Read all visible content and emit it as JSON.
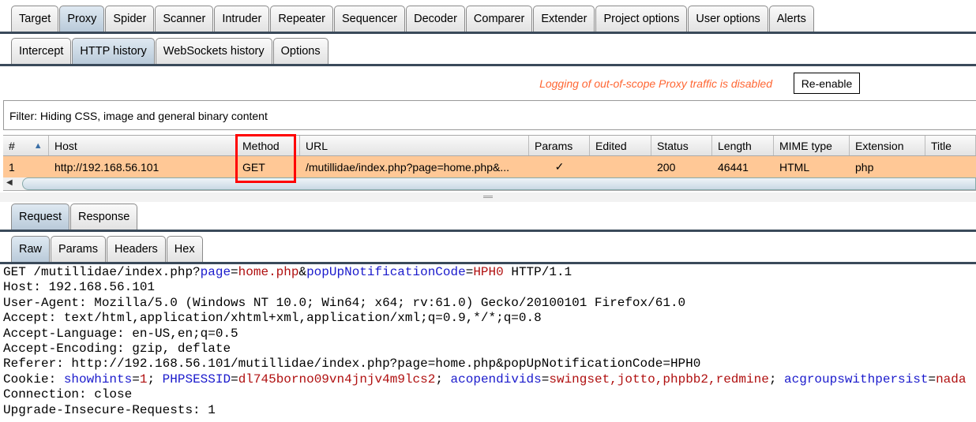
{
  "main_tabs": [
    "Target",
    "Proxy",
    "Spider",
    "Scanner",
    "Intruder",
    "Repeater",
    "Sequencer",
    "Decoder",
    "Comparer",
    "Extender",
    "Project options",
    "User options",
    "Alerts"
  ],
  "main_active": 1,
  "proxy_tabs": [
    "Intercept",
    "HTTP history",
    "WebSockets history",
    "Options"
  ],
  "proxy_active": 1,
  "logging": {
    "message": "Logging of out-of-scope Proxy traffic is disabled",
    "button": "Re-enable"
  },
  "filter": "Filter: Hiding CSS, image and general binary content",
  "table": {
    "columns": [
      "#",
      "Host",
      "Method",
      "URL",
      "Params",
      "Edited",
      "Status",
      "Length",
      "MIME type",
      "Extension",
      "Title"
    ],
    "sort_indicator": "▲",
    "rows": [
      [
        "1",
        "http://192.168.56.101",
        "GET",
        "/mutillidae/index.php?page=home.php&...",
        "✓",
        "",
        "200",
        "46441",
        "HTML",
        "php",
        ""
      ]
    ]
  },
  "msg_tabs": [
    "Request",
    "Response"
  ],
  "view_tabs": [
    "Raw",
    "Params",
    "Headers",
    "Hex"
  ],
  "request_lines": [
    [
      [
        "t",
        "GET /mutillidae/index.php?"
      ],
      [
        "k",
        "page"
      ],
      [
        "t",
        "="
      ],
      [
        "v",
        "home.php"
      ],
      [
        "t",
        "&"
      ],
      [
        "k",
        "popUpNotificationCode"
      ],
      [
        "t",
        "="
      ],
      [
        "v",
        "HPH0"
      ],
      [
        "t",
        " HTTP/1.1"
      ]
    ],
    [
      [
        "t",
        "Host: 192.168.56.101"
      ]
    ],
    [
      [
        "t",
        "User-Agent: Mozilla/5.0 (Windows NT 10.0; Win64; x64; rv:61.0) Gecko/20100101 Firefox/61.0"
      ]
    ],
    [
      [
        "t",
        "Accept: text/html,application/xhtml+xml,application/xml;q=0.9,*/*;q=0.8"
      ]
    ],
    [
      [
        "t",
        "Accept-Language: en-US,en;q=0.5"
      ]
    ],
    [
      [
        "t",
        "Accept-Encoding: gzip, deflate"
      ]
    ],
    [
      [
        "t",
        "Referer: http://192.168.56.101/mutillidae/index.php?page=home.php&popUpNotificationCode=HPH0"
      ]
    ],
    [
      [
        "t",
        "Cookie: "
      ],
      [
        "k",
        "showhints"
      ],
      [
        "t",
        "="
      ],
      [
        "v",
        "1"
      ],
      [
        "t",
        "; "
      ],
      [
        "k",
        "PHPSESSID"
      ],
      [
        "t",
        "="
      ],
      [
        "v",
        "dl745borno09vn4jnjv4m9lcs2"
      ],
      [
        "t",
        "; "
      ],
      [
        "k",
        "acopendivids"
      ],
      [
        "t",
        "="
      ],
      [
        "v",
        "swingset,jotto,phpbb2,redmine"
      ],
      [
        "t",
        "; "
      ],
      [
        "k",
        "acgroupswithpersist"
      ],
      [
        "t",
        "="
      ],
      [
        "v",
        "nada"
      ]
    ],
    [
      [
        "t",
        "Connection: close"
      ]
    ],
    [
      [
        "t",
        "Upgrade-Insecure-Requests: 1"
      ]
    ]
  ]
}
